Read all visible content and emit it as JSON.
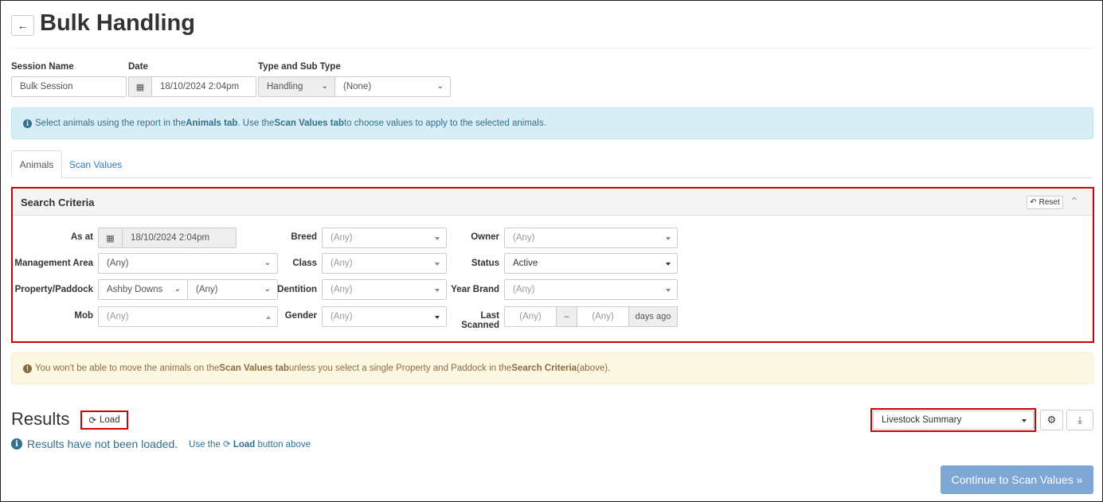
{
  "header": {
    "title": "Bulk Handling",
    "back_icon": "arrow-left-icon"
  },
  "session": {
    "name_label": "Session Name",
    "name_value": "Bulk Session",
    "date_label": "Date",
    "date_value": "18/10/2024 2:04pm",
    "type_label": "Type and Sub Type",
    "type_value": "Handling",
    "subtype_value": "(None)"
  },
  "info_alert": {
    "p1": "Select animals using the report in the ",
    "b1": "Animals tab",
    "p2": " . Use the ",
    "b2": "Scan Values tab",
    "p3": " to choose values to apply to the selected animals."
  },
  "tabs": [
    {
      "label": "Animals",
      "active": true
    },
    {
      "label": "Scan Values",
      "active": false
    }
  ],
  "search": {
    "title": "Search Criteria",
    "reset_label": "Reset",
    "as_at_label": "As at",
    "as_at_value": "18/10/2024 2:04pm",
    "management_area_label": "Management Area",
    "management_area_value": "(Any)",
    "property_paddock_label": "Property/Paddock",
    "property_value": "Ashby Downs",
    "paddock_value": "(Any)",
    "mob_label": "Mob",
    "mob_value": "(Any)",
    "breed_label": "Breed",
    "breed_value": "(Any)",
    "class_label": "Class",
    "class_value": "(Any)",
    "dentition_label": "Dentition",
    "dentition_value": "(Any)",
    "gender_label": "Gender",
    "gender_value": "(Any)",
    "owner_label": "Owner",
    "owner_value": "(Any)",
    "status_label": "Status",
    "status_value": "Active",
    "year_brand_label": "Year Brand",
    "year_brand_value": "(Any)",
    "last_scanned_label": "Last Scanned",
    "last_scanned_from": "(Any)",
    "last_scanned_sep": "–",
    "last_scanned_to": "(Any)",
    "last_scanned_suffix": "days ago"
  },
  "warn_alert": {
    "p1": "You won't be able to move the animals on the ",
    "b1": "Scan Values tab",
    "p2": " unless you select a single Property and Paddock in the ",
    "b2": "Search Criteria",
    "p3": " (above)."
  },
  "results": {
    "title": "Results",
    "load_label": "Load",
    "not_loaded": "Results have not been loaded.",
    "hint_prefix": "Use the",
    "hint_bold": "Load",
    "hint_suffix": "button above",
    "report_value": "Livestock Summary",
    "continue_label": "Continue to Scan Values »"
  },
  "colors": {
    "highlight": "#d00000",
    "link": "#337ab7",
    "info_bg": "#d9edf7",
    "warn_bg": "#fcf8e3",
    "primary_disabled": "#7ea7d6"
  }
}
